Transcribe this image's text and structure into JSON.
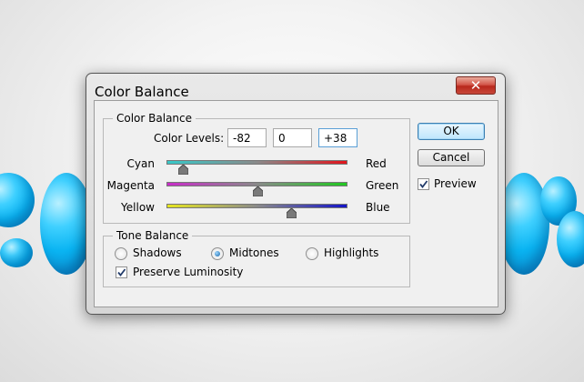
{
  "dialog": {
    "title": "Color Balance",
    "close_glyph": "✕",
    "color_balance_group": {
      "legend": "Color Balance",
      "levels_label": "Color Levels:",
      "levels": [
        "-82",
        "0",
        "+38"
      ],
      "sliders": [
        {
          "left": "Cyan",
          "right": "Red",
          "value": -82,
          "min": -100,
          "max": 100,
          "track_colors": [
            "#37c8c8",
            "#e2141c"
          ]
        },
        {
          "left": "Magenta",
          "right": "Green",
          "value": 0,
          "min": -100,
          "max": 100,
          "track_colors": [
            "#c82dc8",
            "#20c820"
          ]
        },
        {
          "left": "Yellow",
          "right": "Blue",
          "value": 38,
          "min": -100,
          "max": 100,
          "track_colors": [
            "#e6e620",
            "#1414c8"
          ]
        }
      ]
    },
    "tone_balance_group": {
      "legend": "Tone Balance",
      "options": [
        {
          "label": "Shadows",
          "selected": false
        },
        {
          "label": "Midtones",
          "selected": true
        },
        {
          "label": "Highlights",
          "selected": false
        }
      ],
      "preserve_luminosity": {
        "label": "Preserve Luminosity",
        "checked": true
      }
    },
    "buttons": {
      "ok": "OK",
      "cancel": "Cancel"
    },
    "preview": {
      "label": "Preview",
      "checked": true
    }
  }
}
